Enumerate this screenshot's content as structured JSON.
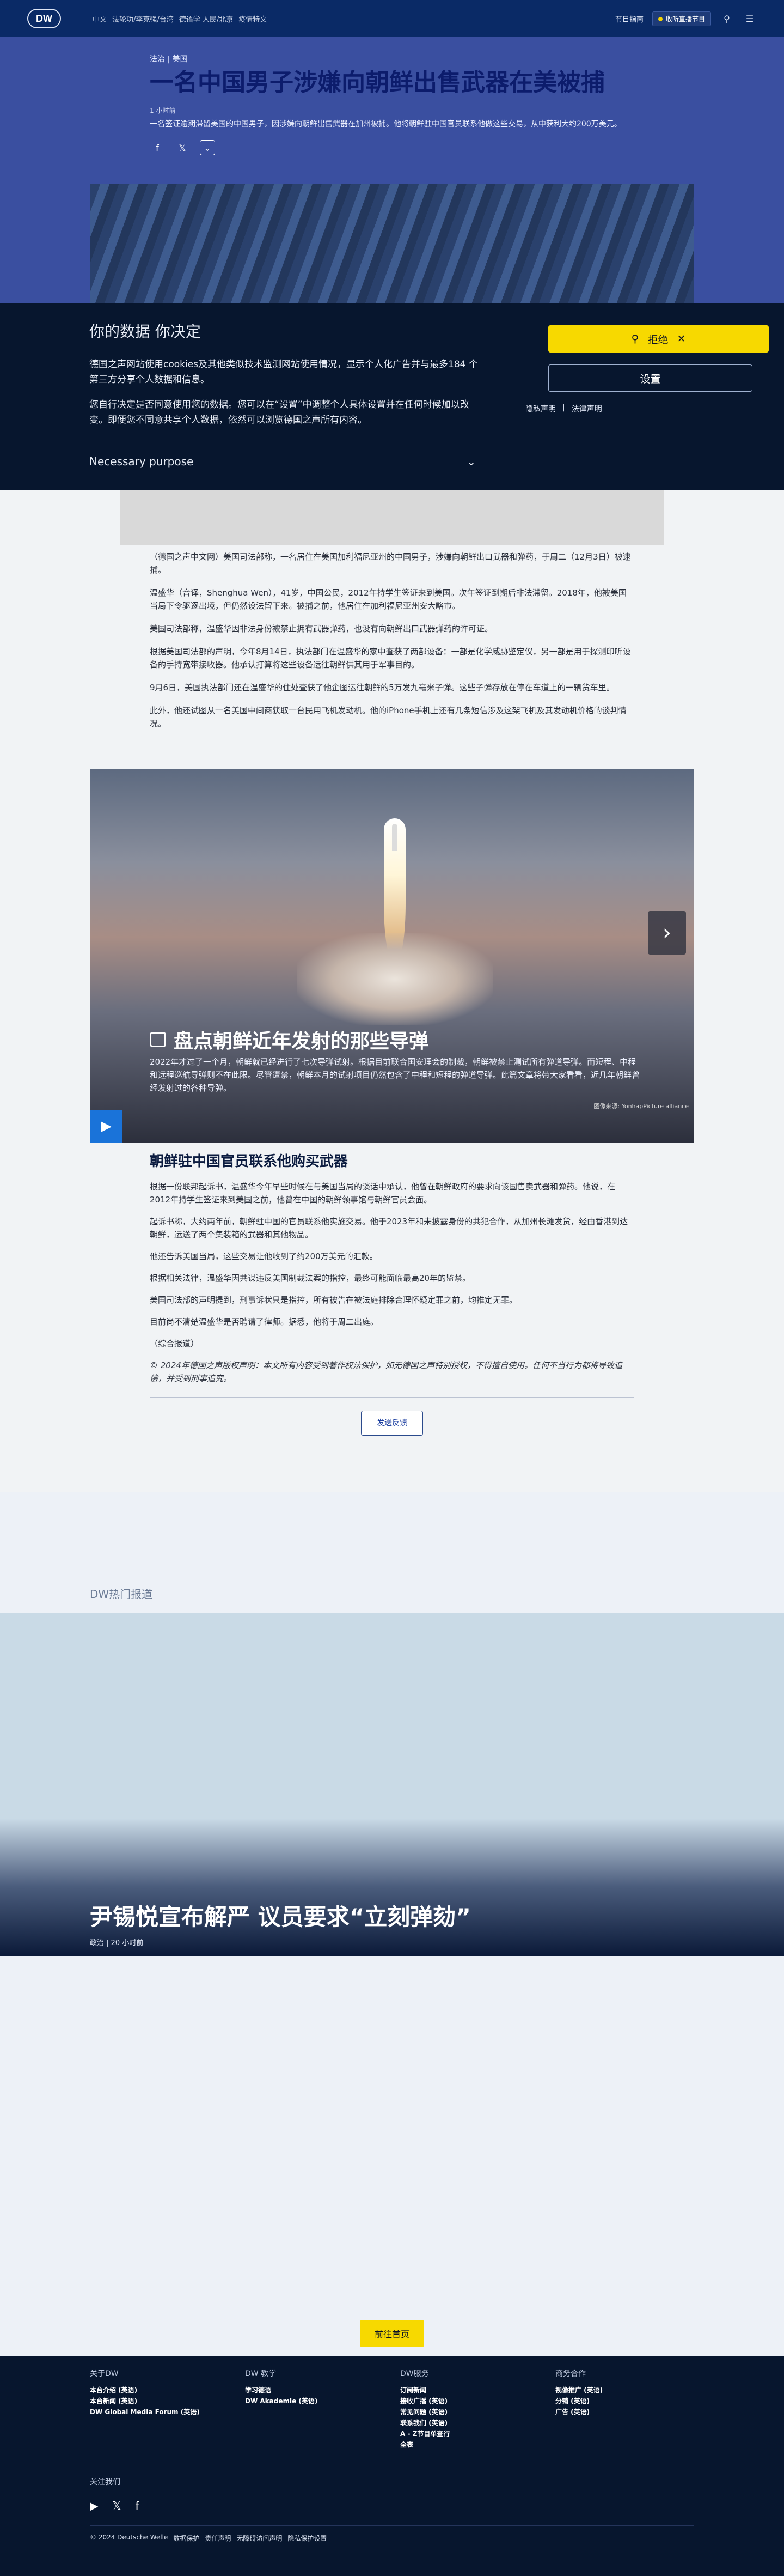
{
  "header": {
    "logo": "DW",
    "nav": [
      "中文",
      "法轮功/李克强/台湾",
      "德语学 人民/北京",
      "疫情特文"
    ],
    "program_guide": "节目指南",
    "live_label": "收听直播节目",
    "icons": [
      "search-icon",
      "menu-icon"
    ]
  },
  "hero": {
    "kicker": "法治 | 美国",
    "title": "一名中国男子涉嫌向朝鲜出售武器在美被捕",
    "time": "1 小时前",
    "teaser": "一名签证逾期滞留美国的中国男子，因涉嫌向朝鲜出售武器在加州被捕。他将朝鲜驻中国官员联系他做这些交易，从中获利大约200万美元。",
    "share": [
      "facebook-icon",
      "x-icon"
    ]
  },
  "consent": {
    "title": "你的数据 你决定",
    "p1": "德国之声网站使用cookies及其他类似技术监测网站使用情况，显示个人化广告并与最多184 个第三方分享个人数据和信息。",
    "p2": "您自行决定是否同意使用您的数据。您可以在“设置”中调整个人具体设置并在任何时候加以改变。即便您不同意共享个人数据，依然可以浏览德国之声所有内容。",
    "purpose": "Necessary purpose",
    "reject": "拒绝",
    "settings": "设置",
    "privacy": "隐私声明",
    "legal": "法律声明"
  },
  "article": {
    "p1": "（德国之声中文网）美国司法部称，一名居住在美国加利福尼亚州的中国男子，涉嫌向朝鲜出口武器和弹药，于周二（12月3日）被逮捕。",
    "p2": "温盛华（音译，Shenghua Wen），41岁，中国公民，2012年持学生签证来到美国。次年签证到期后非法滞留。2018年，他被美国当局下令驱逐出境，但仍然设法留下来。被捕之前，他居住在加利福尼亚州安大略市。",
    "p3": "美国司法部称，温盛华因非法身份被禁止拥有武器弹药，也没有向朝鲜出口武器弹药的许可证。",
    "p4": "根据美国司法部的声明，今年8月14日，执法部门在温盛华的家中查获了两部设备：一部是化学威胁鉴定仪，另一部是用于探测印听设备的手持宽带接收器。他承认打算将这些设备运往朝鲜供其用于军事目的。",
    "p5": "9月6日，美国执法部门还在温盛华的住处查获了他企图运往朝鲜的5万发九毫米子弹。这些子弹存放在停在车道上的一辆货车里。",
    "p6": "此外，他还试图从一名美国中间商获取一台民用飞机发动机。他的iPhone手机上还有几条短信涉及这架飞机及其发动机价格的谈判情况。"
  },
  "gallery": {
    "title": "盘点朝鲜近年发射的那些导弹",
    "desc": "2022年才过了一个月，朝鲜就已经进行了七次导弹试射。根据目前联合国安理会的制裁，朝鲜被禁止测试所有弹道导弹。而短程、中程和远程巡航导弹则不在此限。尽管遭禁，朝鲜本月的试射项目仍然包含了中程和短程的弹道导弹。此篇文章将带大家看看，近几年朝鲜曾经发射过的各种导弹。",
    "credit": "图像来源: YonhapPicture alliance"
  },
  "article2": {
    "subhead": "朝鲜驻中国官员联系他购买武器",
    "p1": "根据一份联邦起诉书，温盛华今年早些时候在与美国当局的谈话中承认，他曾在朝鲜政府的要求向该国售卖武器和弹药。他说，在2012年持学生签证来到美国之前，他曾在中国的朝鲜领事馆与朝鲜官员会面。",
    "p2": "起诉书称，大约两年前，朝鲜驻中国的官员联系他实施交易。他于2023年和未披露身份的共犯合作，从加州长滩发货，经由香港到达朝鲜，运送了两个集装箱的武器和其他物品。",
    "p3": "他还告诉美国当局，这些交易让他收到了约200万美元的汇款。",
    "p4": "根据相关法律，温盛华因共谋违反美国制裁法案的指控，最终可能面临最高20年的监禁。",
    "p5": "美国司法部的声明提到，刑事诉状只是指控，所有被告在被法庭排除合理怀疑定罪之前，均推定无罪。",
    "p6": "目前尚不清楚温盛华是否聘请了律师。据悉，他将于周二出庭。",
    "p7": "（综合报道）",
    "copyright": "© 2024年德国之声版权声明：本文所有内容受到著作权法保护，如无德国之声特别授权，不得擅自使用。任何不当行为都将导致追偿，并受到刑事追究。",
    "feedback": "发送反馈"
  },
  "hot": {
    "label": "DW热门报道",
    "title": "尹锡悦宣布解严 议员要求“立刻弹劾”",
    "meta": "政治 | 20 小时前"
  },
  "home_button": "前往首页",
  "footer": {
    "col1_title": "关于DW",
    "col1": [
      "本台介绍 (英语)",
      "本台新闻 (英语)",
      "DW Global Media Forum (英语)"
    ],
    "col2_title": "DW 教学",
    "col2": [
      "学习德语",
      "DW Akademie (英语)"
    ],
    "col3_title": "DW服务",
    "col3": [
      "订阅新闻",
      "接收广播 (英语)",
      "常见问题 (英语)",
      "联系我们 (英语)",
      "A - Z节目单查行",
      "全表"
    ],
    "col4_title": "商务合作",
    "col4": [
      "视像推广 (英语)",
      "分销 (英语)",
      "广告 (英语)"
    ],
    "follow": "关注我们",
    "social": [
      "youtube-icon",
      "x-icon",
      "facebook-icon"
    ],
    "legal": [
      "© 2024 Deutsche Welle",
      "数据保护",
      "责任声明",
      "无障碍访问声明",
      "隐私保护设置"
    ]
  }
}
